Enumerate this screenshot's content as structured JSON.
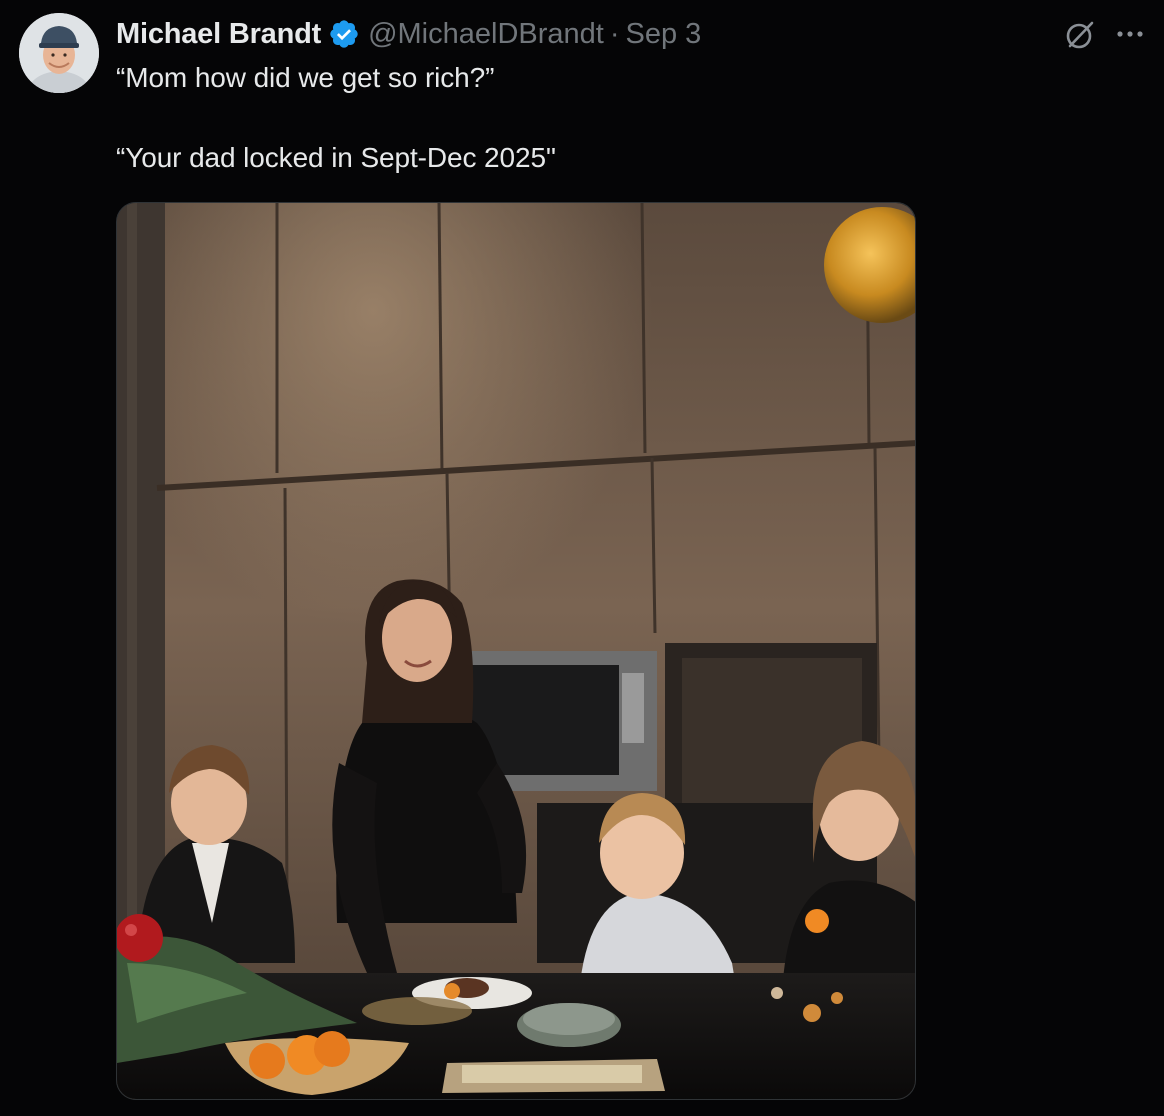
{
  "tweet": {
    "author": {
      "display_name": "Michael Brandt",
      "handle": "@MichaelDBrandt",
      "verified": true
    },
    "date": "Sep 3",
    "separator": "·",
    "text_lines": [
      "“Mom how did we get so rich?”",
      "“Your dad locked in Sept-Dec 2025\""
    ],
    "icons": {
      "verified": "verified-badge-icon",
      "grok": "grok-icon",
      "more": "more-options-icon"
    },
    "colors": {
      "background": "#050506",
      "text_primary": "#e7e9ea",
      "text_secondary": "#71767b",
      "verified_blue": "#1d9bf0"
    }
  }
}
